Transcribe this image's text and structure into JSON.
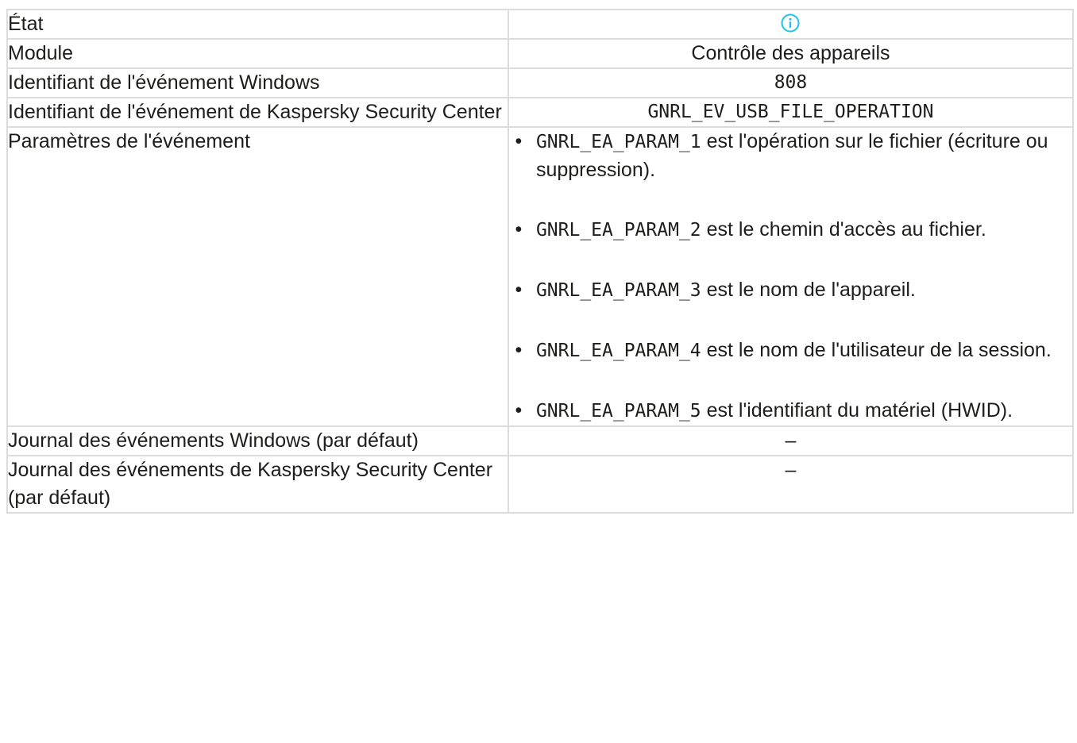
{
  "rows": {
    "state": {
      "label": "État",
      "icon": "info-icon",
      "icon_color": "#1ec4e6"
    },
    "module": {
      "label": "Module",
      "value": "Contrôle des appareils"
    },
    "windows_event_id": {
      "label": "Identifiant de l'événement Windows",
      "value": "808"
    },
    "ksc_event_id": {
      "label": "Identifiant de l'événement de Kaspersky Security Center",
      "value": "GNRL_EV_USB_FILE_OPERATION"
    },
    "event_params": {
      "label": "Paramètres de l'événement",
      "items": [
        {
          "code": "GNRL_EA_PARAM_1",
          "text": " est l'opération sur le fichier (écriture ou suppression)."
        },
        {
          "code": "GNRL_EA_PARAM_2",
          "text": " est le chemin d'accès au fichier."
        },
        {
          "code": "GNRL_EA_PARAM_3",
          "text": " est le nom de l'appareil."
        },
        {
          "code": "GNRL_EA_PARAM_4",
          "text": " est le nom de l'utilisateur de la session."
        },
        {
          "code": "GNRL_EA_PARAM_5",
          "text": " est l'identifiant du matériel (HWID)."
        }
      ]
    },
    "windows_log": {
      "label": "Journal des événements Windows (par défaut)",
      "value": "–"
    },
    "ksc_log": {
      "label": "Journal des événements de Kaspersky Security Center (par défaut)",
      "value": "–"
    }
  }
}
